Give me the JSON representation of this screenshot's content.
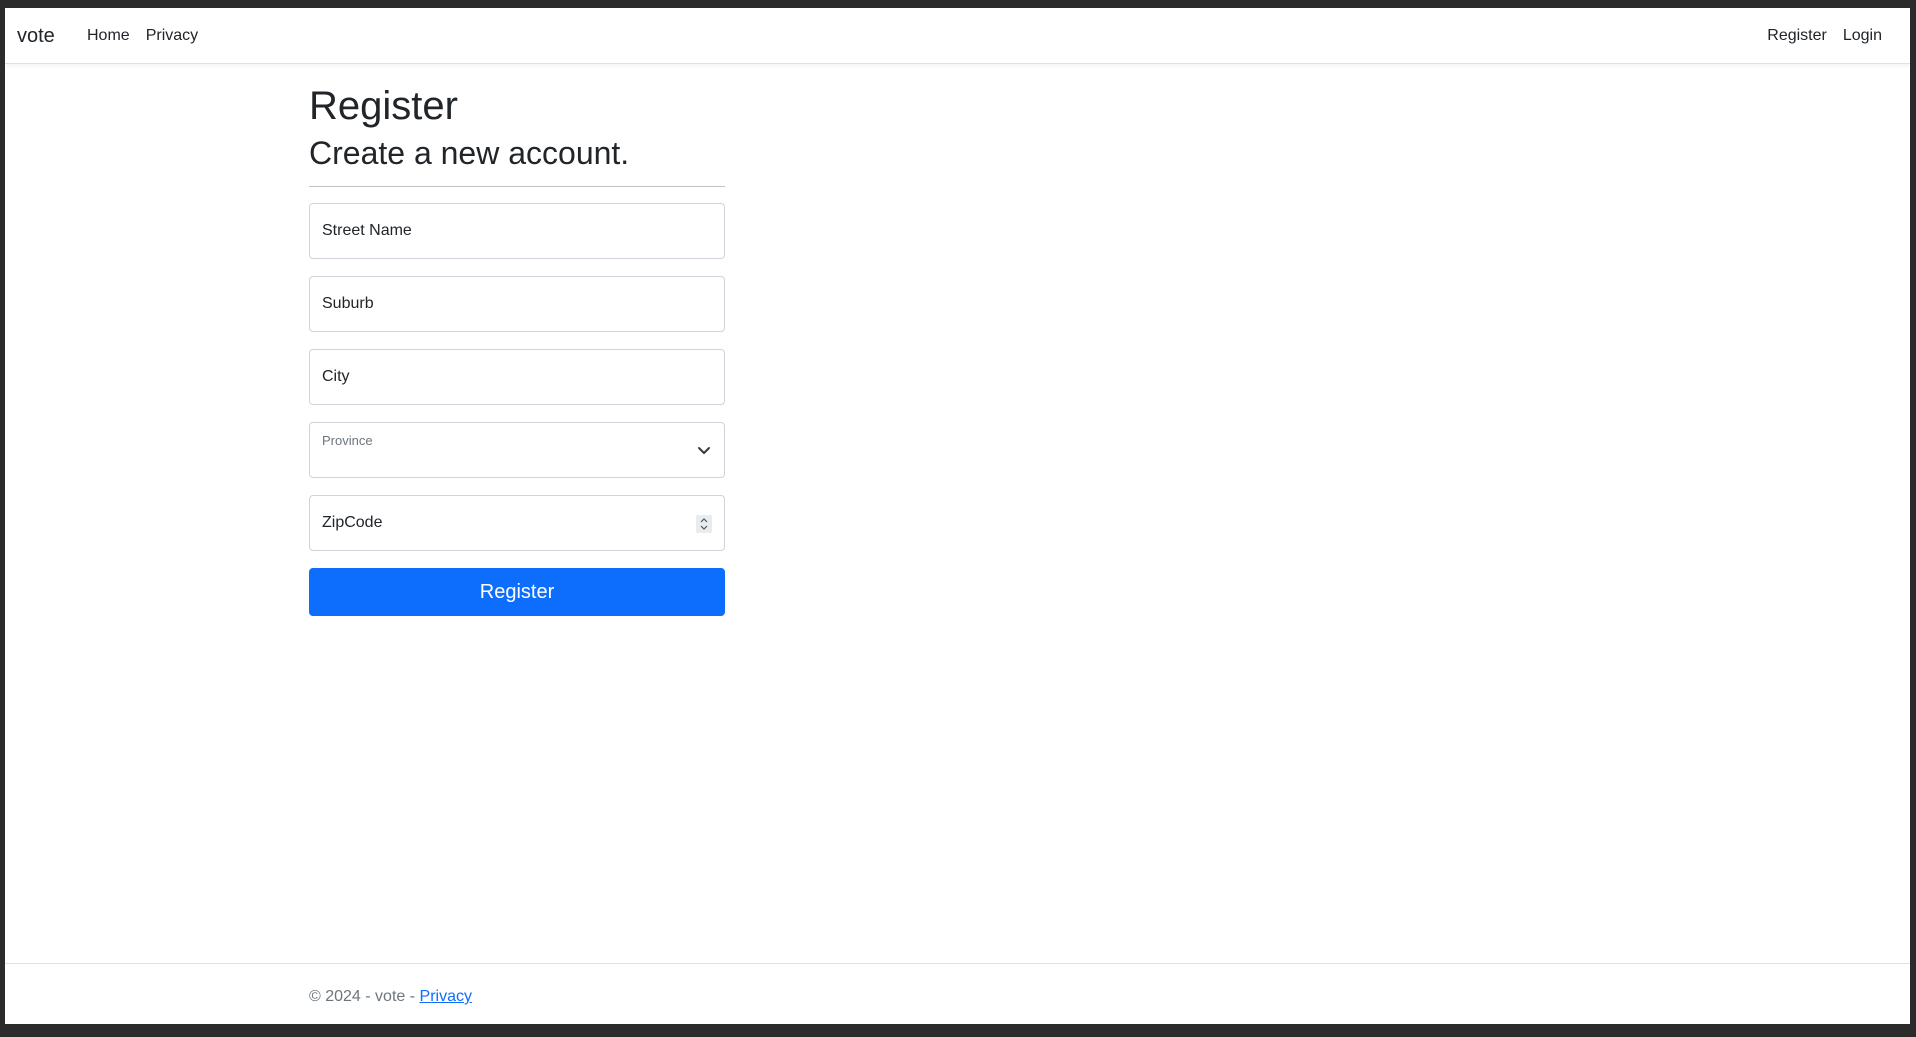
{
  "navbar": {
    "brand": "vote",
    "left_links": [
      "Home",
      "Privacy"
    ],
    "right_links": [
      "Register",
      "Login"
    ]
  },
  "page": {
    "title": "Register",
    "subtitle": "Create a new account."
  },
  "form": {
    "street_placeholder": "Street Name",
    "suburb_placeholder": "Suburb",
    "city_placeholder": "City",
    "province_label": "Province",
    "zipcode_placeholder": "ZipCode",
    "submit_label": "Register"
  },
  "footer": {
    "text": "© 2024 - vote - ",
    "link": "Privacy"
  },
  "colors": {
    "primary": "#0d6efd",
    "border": "#ced4da",
    "muted": "#6c757d"
  }
}
